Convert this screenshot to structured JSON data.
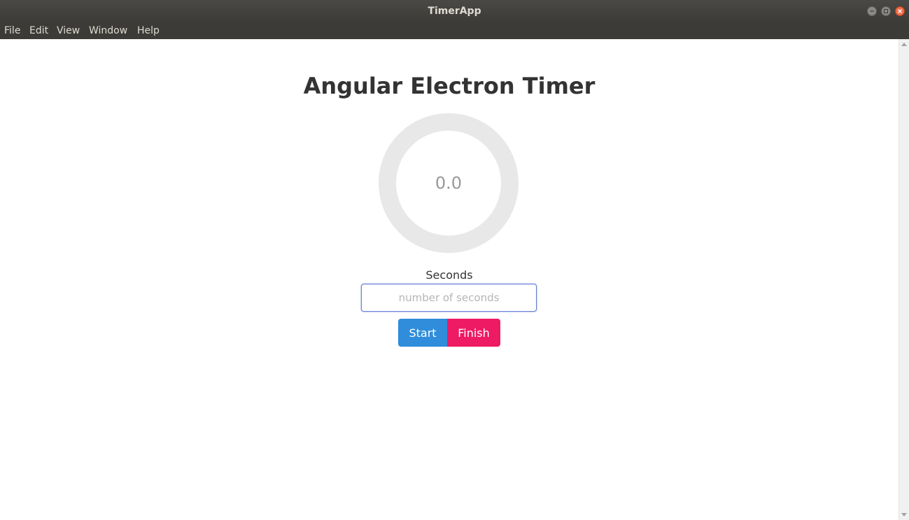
{
  "window": {
    "title": "TimerApp",
    "controls": [
      "minimize-icon",
      "maximize-icon",
      "close-icon"
    ]
  },
  "menu": {
    "items": [
      "File",
      "Edit",
      "View",
      "Window",
      "Help"
    ]
  },
  "main": {
    "heading": "Angular Electron Timer",
    "timer_value": "0.0",
    "timer_progress": 0,
    "ring_color": "#e8e8e8",
    "seconds_label": "Seconds",
    "seconds_input": {
      "value": "",
      "placeholder": "number of seconds"
    },
    "start_label": "Start",
    "finish_label": "Finish"
  },
  "colors": {
    "start_button": "#2f8ddb",
    "finish_button": "#ee1a63",
    "title_bar": "#3c3b37"
  }
}
